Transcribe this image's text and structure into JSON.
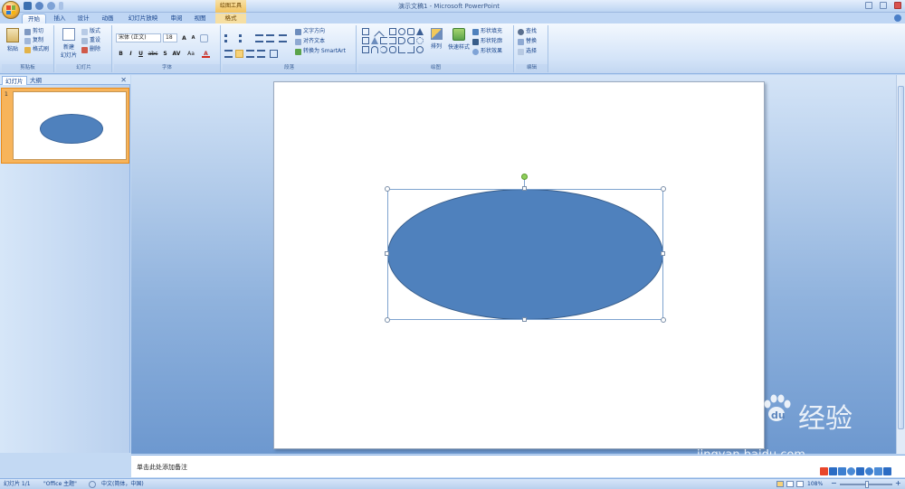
{
  "titlebar": {
    "contextual_tool": "绘图工具",
    "window_title": "演示文稿1 - Microsoft PowerPoint"
  },
  "tabs": [
    {
      "label": "开始",
      "active": true
    },
    {
      "label": "插入"
    },
    {
      "label": "设计"
    },
    {
      "label": "动画"
    },
    {
      "label": "幻灯片放映"
    },
    {
      "label": "审阅"
    },
    {
      "label": "视图"
    },
    {
      "label": "格式",
      "contextual": true
    }
  ],
  "ribbon": {
    "clipboard": {
      "paste": "粘贴",
      "cut": "剪切",
      "copy": "复制",
      "format_painter": "格式刷",
      "label": "剪贴板"
    },
    "slides": {
      "new_slide": "新建",
      "new_slide_2": "幻灯片",
      "layout": "版式",
      "reset": "重设",
      "delete": "删除",
      "label": "幻灯片"
    },
    "font": {
      "font_name": "宋体 (正文)",
      "font_size": "18",
      "bold": "B",
      "italic": "I",
      "underline": "U",
      "strike": "abc",
      "shadow": "S",
      "spacing": "AV",
      "case": "Aa",
      "color": "A",
      "label": "字体"
    },
    "paragraph": {
      "text_direction": "文字方向",
      "align_text": "对齐文本",
      "convert_smartart": "转换为 SmartArt",
      "label": "段落"
    },
    "drawing": {
      "arrange": "排列",
      "quick_styles": "快速样式",
      "shape_fill": "形状填充",
      "shape_outline": "形状轮廓",
      "shape_effects": "形状效果",
      "label": "绘图"
    },
    "editing": {
      "find": "查找",
      "replace": "替换",
      "select": "选择",
      "label": "编辑"
    }
  },
  "panel": {
    "tab_slides": "幻灯片",
    "tab_outline": "大纲",
    "slide_number": "1"
  },
  "notes": {
    "placeholder": "单击此处添加备注"
  },
  "status": {
    "slide_count": "幻灯片 1/1",
    "theme": "\"Office 主题\"",
    "language": "中文(简体，中国)",
    "zoom": "108%"
  },
  "watermark": {
    "brand": "Bai",
    "brand_tail": "du",
    "cn": "经验",
    "url": "jingyan.baidu.com"
  },
  "colors": {
    "shape_fill": "#4f81bd",
    "shape_outline": "#385d8a",
    "selected_thumb": "#f7b45b"
  }
}
